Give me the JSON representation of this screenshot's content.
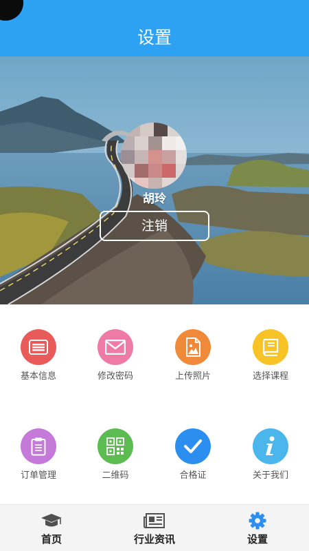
{
  "header": {
    "title": "设置"
  },
  "profile": {
    "name": "胡玲",
    "logout_label": "注销"
  },
  "menu": {
    "items": [
      {
        "label": "基本信息",
        "icon": "id-card-icon",
        "color": "#e95a5a"
      },
      {
        "label": "修改密码",
        "icon": "envelope-icon",
        "color": "#ee7aa6"
      },
      {
        "label": "上传照片",
        "icon": "image-file-icon",
        "color": "#f0893a"
      },
      {
        "label": "选择课程",
        "icon": "book-icon",
        "color": "#f7c326"
      },
      {
        "label": "订单管理",
        "icon": "clipboard-icon",
        "color": "#c57ad9"
      },
      {
        "label": "二维码",
        "icon": "qr-code-icon",
        "color": "#5cbc52"
      },
      {
        "label": "合格证",
        "icon": "checkmark-icon",
        "color": "#2c8ff0"
      },
      {
        "label": "关于我们",
        "icon": "info-icon",
        "color": "#4ab6ec"
      }
    ]
  },
  "nav": {
    "items": [
      {
        "label": "首页",
        "icon": "graduation-cap-icon"
      },
      {
        "label": "行业资讯",
        "icon": "newspaper-icon"
      },
      {
        "label": "设置",
        "icon": "gear-icon"
      }
    ],
    "active_color": "#2c8ff0"
  }
}
